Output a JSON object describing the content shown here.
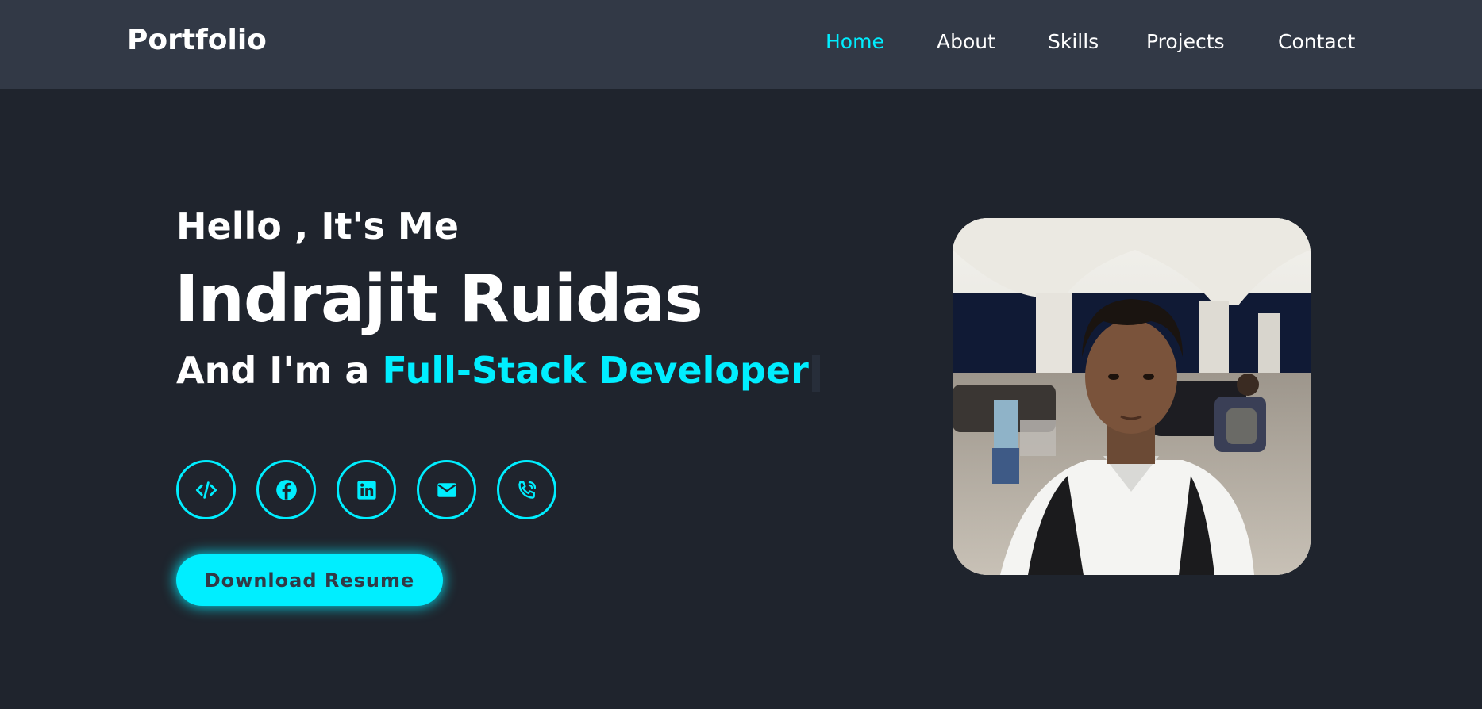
{
  "header": {
    "logo": "Portfolio",
    "nav": [
      {
        "label": "Home",
        "active": true
      },
      {
        "label": "About",
        "active": false
      },
      {
        "label": "Skills",
        "active": false
      },
      {
        "label": "Projects",
        "active": false
      },
      {
        "label": "Contact",
        "active": false
      }
    ]
  },
  "hero": {
    "greeting": "Hello , It's Me",
    "name": "Indrajit Ruidas",
    "role_prefix": "And I'm a",
    "role_highlight": "Full-Stack Developer",
    "download_button": "Download Resume"
  },
  "social": [
    {
      "name": "code-icon"
    },
    {
      "name": "facebook-icon"
    },
    {
      "name": "linkedin-icon"
    },
    {
      "name": "email-icon"
    },
    {
      "name": "phone-icon"
    }
  ],
  "colors": {
    "background": "#1f242d",
    "header": "#323946",
    "accent": "#00eeff",
    "text": "#ffffff"
  }
}
